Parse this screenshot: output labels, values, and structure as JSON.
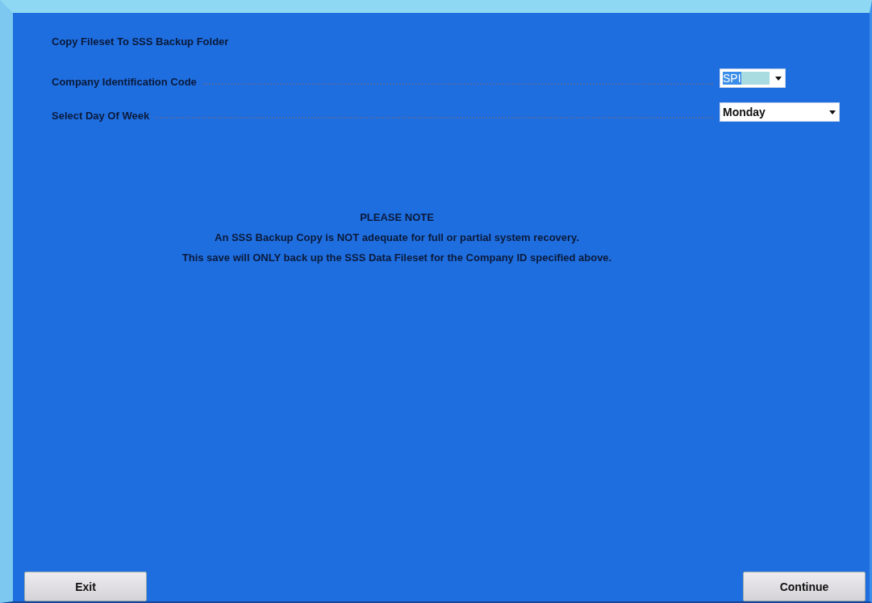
{
  "title": "Copy Fileset To SSS Backup Folder",
  "fields": [
    {
      "label": "Company Identification Code",
      "value": "SPI",
      "highlighted": true
    },
    {
      "label": "Select Day Of Week",
      "value": "Monday",
      "highlighted": false
    }
  ],
  "note": {
    "heading": "PLEASE NOTE",
    "lines": [
      "An SSS Backup Copy is NOT adequate for full or partial system recovery.",
      "This save will ONLY back up the SSS Data Fileset for the Company ID specified above."
    ]
  },
  "buttons": [
    {
      "label": "Exit"
    },
    {
      "label": "Continue"
    }
  ]
}
